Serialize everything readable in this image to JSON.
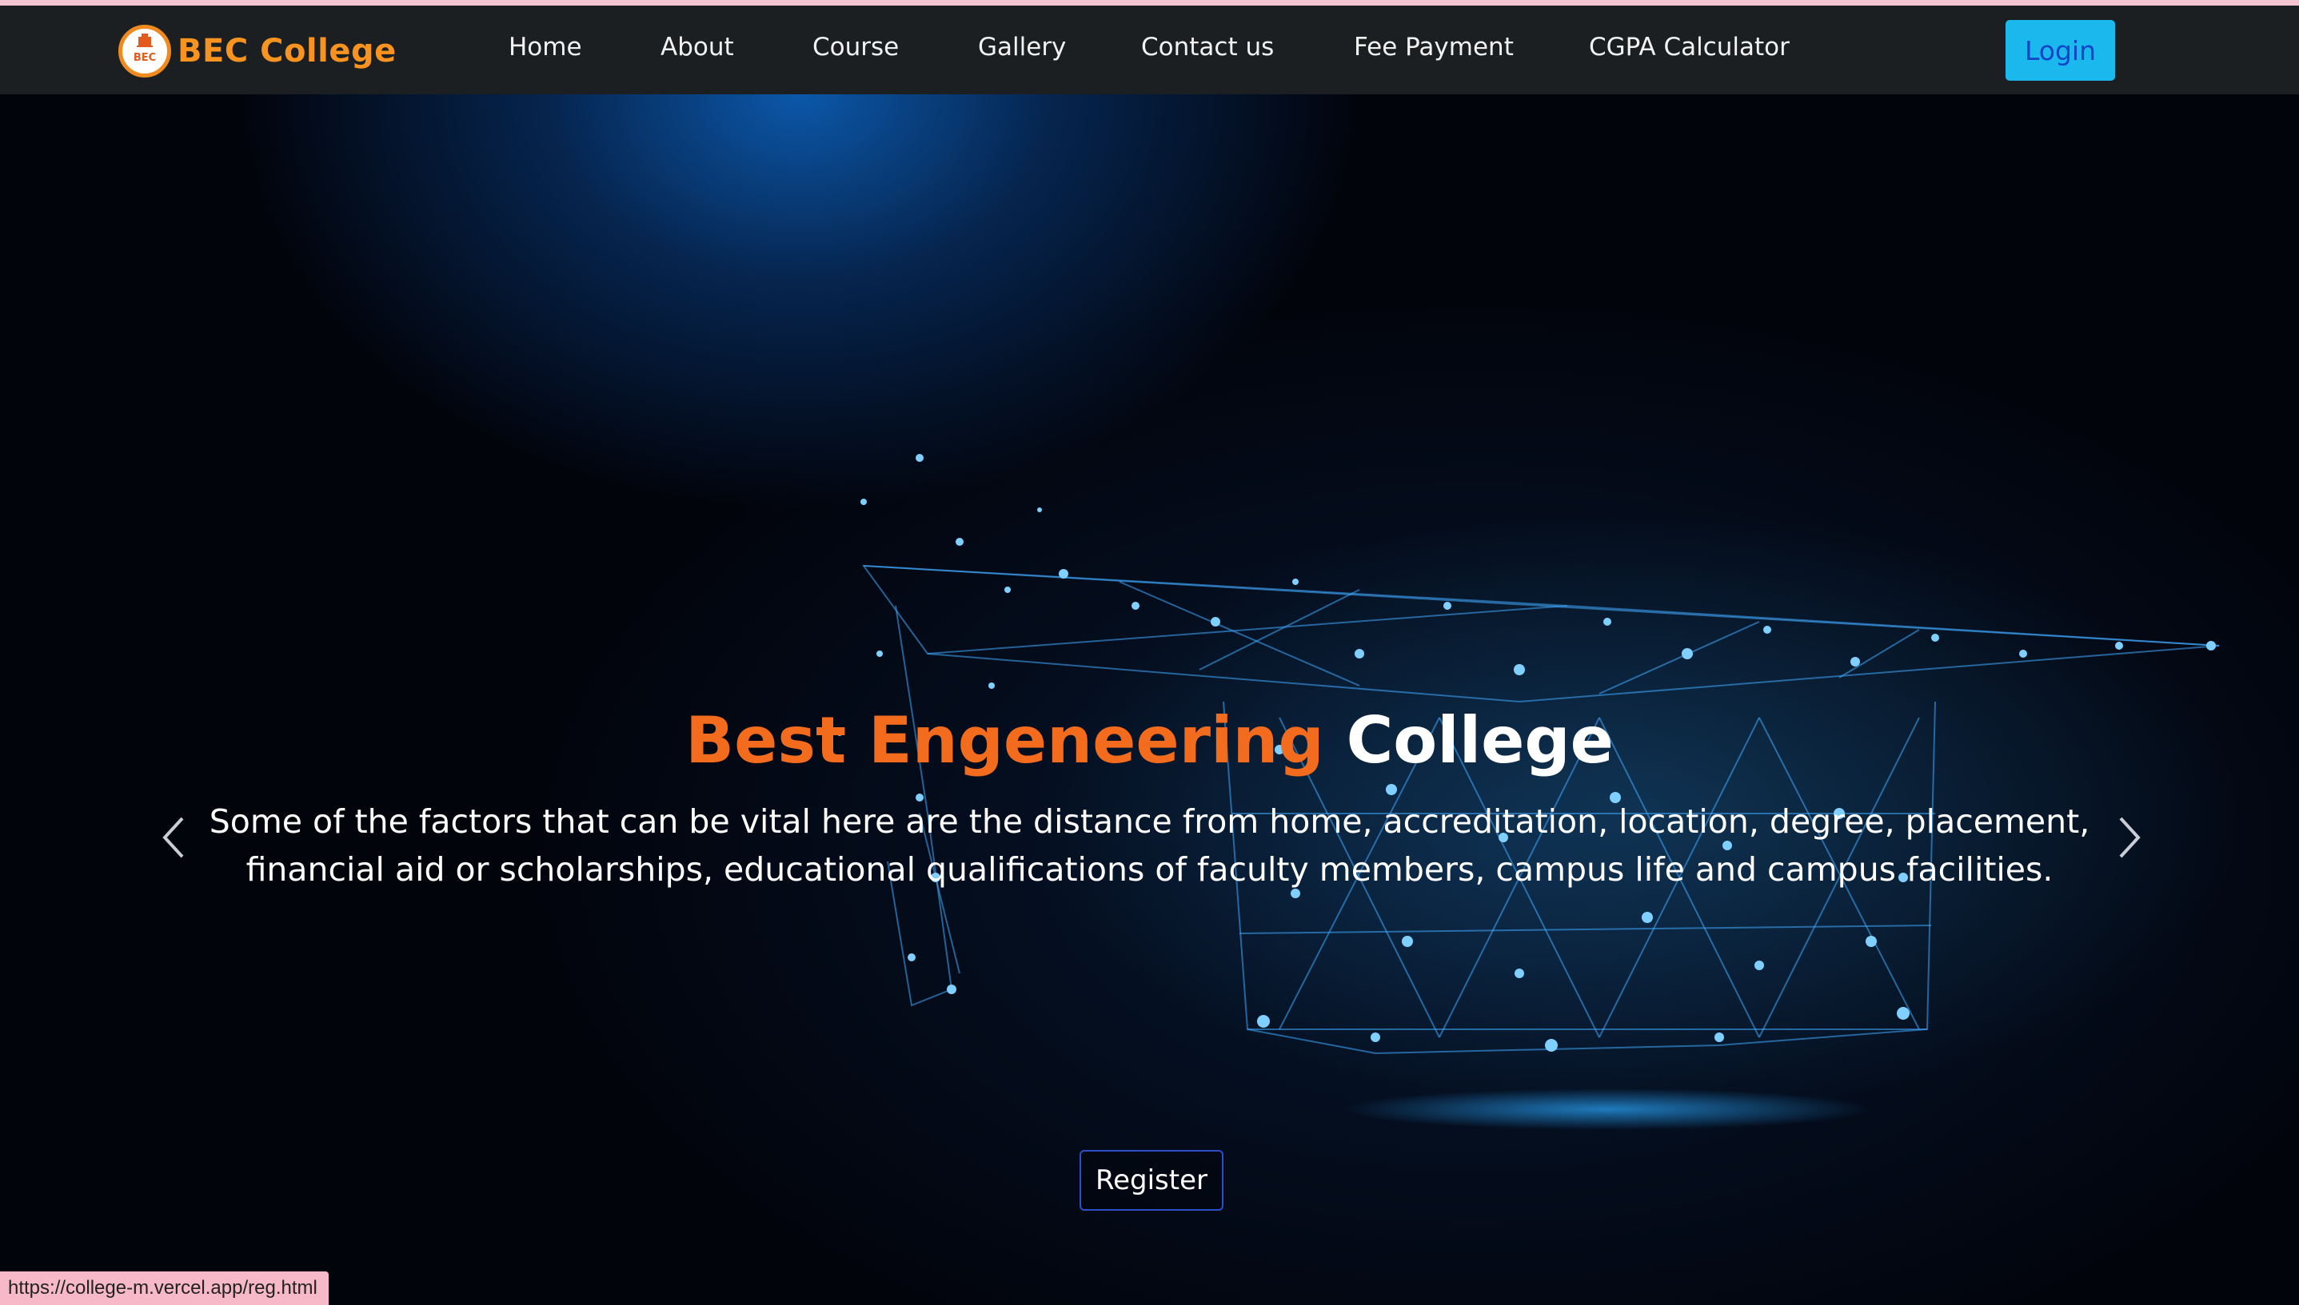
{
  "brand": {
    "name": "BEC College",
    "logo_text": "BEC",
    "logo_icon": "college-emblem-icon",
    "color": "#f7931e"
  },
  "nav": {
    "items": [
      {
        "label": "Home"
      },
      {
        "label": "About"
      },
      {
        "label": "Course"
      },
      {
        "label": "Gallery"
      },
      {
        "label": "Contact us"
      },
      {
        "label": "Fee Payment"
      },
      {
        "label": "CGPA Calculator"
      }
    ],
    "login_label": "Login"
  },
  "hero": {
    "title_accent": "Best Engeneering",
    "title_rest": "College",
    "description": "Some of the factors that can be vital here are the distance from home, accreditation, location, degree, placement, financial aid or scholarships, educational qualifications of faculty members, campus life and campus facilities.",
    "register_label": "Register",
    "prev_icon": "chevron-left-icon",
    "next_icon": "chevron-right-icon",
    "background_image": "graduation-cap-network-illustration"
  },
  "status_bar": {
    "url": "https://college-m.vercel.app/reg.html"
  },
  "colors": {
    "accent": "#f36b1c",
    "login_bg": "#1ab8ec",
    "register_border": "#2b4fc9"
  }
}
